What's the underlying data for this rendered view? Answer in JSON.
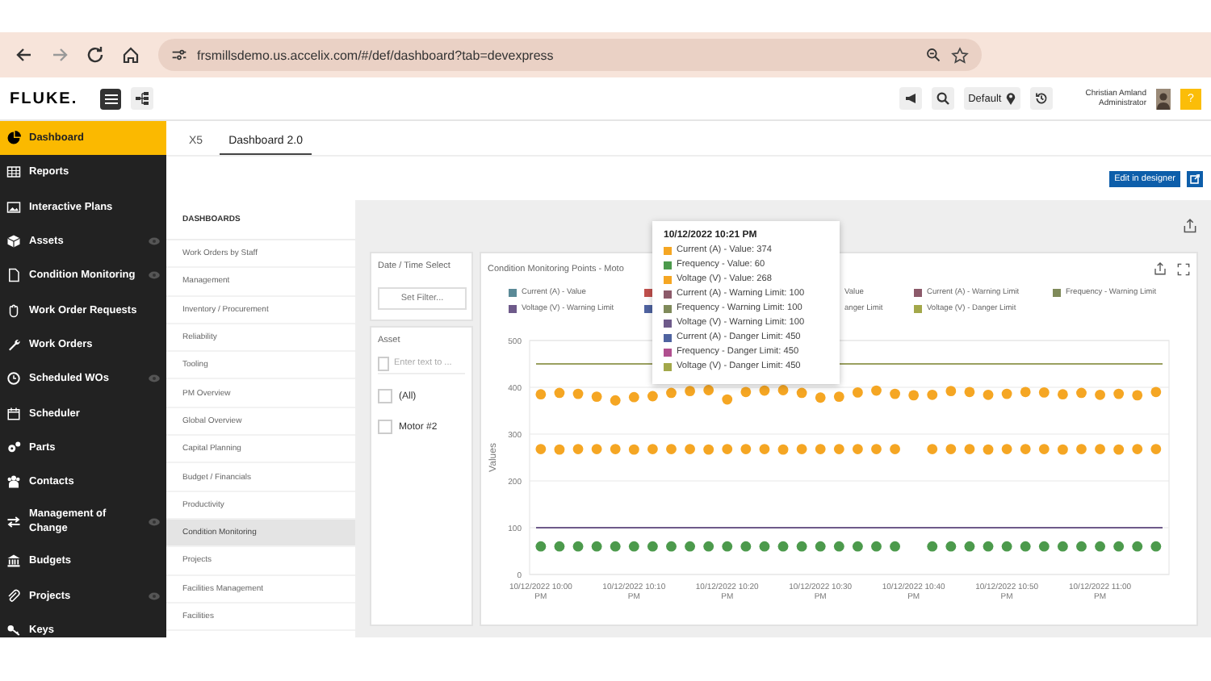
{
  "browser": {
    "url": "frsmillsdemo.us.accelix.com/#/def/dashboard?tab=devexpress"
  },
  "header": {
    "logo": "FLUKE.",
    "profile": "Default",
    "user_name": "Christian Amland",
    "user_role": "Administrator",
    "help": "?"
  },
  "sidebar": {
    "items": [
      {
        "label": "Dashboard",
        "selected": true,
        "eye": false
      },
      {
        "label": "Reports",
        "selected": false,
        "eye": false
      },
      {
        "label": "Interactive Plans",
        "selected": false,
        "eye": false
      },
      {
        "label": "Assets",
        "selected": false,
        "eye": true
      },
      {
        "label": "Condition Monitoring",
        "selected": false,
        "eye": true
      },
      {
        "label": "Work Order Requests",
        "selected": false,
        "eye": false
      },
      {
        "label": "Work Orders",
        "selected": false,
        "eye": false
      },
      {
        "label": "Scheduled WOs",
        "selected": false,
        "eye": true
      },
      {
        "label": "Scheduler",
        "selected": false,
        "eye": false
      },
      {
        "label": "Parts",
        "selected": false,
        "eye": false
      },
      {
        "label": "Contacts",
        "selected": false,
        "eye": false
      },
      {
        "label": "Management of Change",
        "selected": false,
        "eye": true
      },
      {
        "label": "Budgets",
        "selected": false,
        "eye": false
      },
      {
        "label": "Projects",
        "selected": false,
        "eye": true
      },
      {
        "label": "Keys",
        "selected": false,
        "eye": false
      }
    ]
  },
  "tabs": [
    {
      "label": "X5",
      "selected": false
    },
    {
      "label": "Dashboard 2.0",
      "selected": true
    }
  ],
  "edit_button": "Edit in designer",
  "dashboards": {
    "heading": "DASHBOARDS",
    "items": [
      {
        "label": "Work Orders by Staff",
        "selected": false
      },
      {
        "label": "Management",
        "selected": false
      },
      {
        "label": "Inventory / Procurement",
        "selected": false
      },
      {
        "label": "Reliability",
        "selected": false
      },
      {
        "label": "Tooling",
        "selected": false
      },
      {
        "label": "PM Overview",
        "selected": false
      },
      {
        "label": "Global Overview",
        "selected": false
      },
      {
        "label": "Capital Planning",
        "selected": false
      },
      {
        "label": "Budget / Financials",
        "selected": false
      },
      {
        "label": "Productivity",
        "selected": false
      },
      {
        "label": "Condition Monitoring",
        "selected": true
      },
      {
        "label": "Projects",
        "selected": false
      },
      {
        "label": "Facilities Management",
        "selected": false
      },
      {
        "label": "Facilities",
        "selected": false
      }
    ]
  },
  "date_filter": {
    "title": "Date / Time Select",
    "button": "Set Filter..."
  },
  "asset_filter": {
    "title": "Asset",
    "placeholder": "Enter text to ...",
    "select_all_checked": false,
    "options": [
      {
        "label": "(All)",
        "checked": false
      },
      {
        "label": "Motor #2",
        "checked": false
      }
    ]
  },
  "chart_panel": {
    "title": "Condition Monitoring Points - Moto",
    "legend": [
      {
        "label": "Current (A) - Value",
        "color": "#5b8a97"
      },
      {
        "color": "#c0504d"
      },
      {
        "label": "Value"
      },
      {
        "label": "Current (A) - Warning Limit",
        "color": "#8c5a6a"
      },
      {
        "label": "Frequency - Warning Limit",
        "color": "#7f8a5a"
      },
      {
        "label": "Voltage (V) - Warning Limit",
        "color": "#6e5a8a"
      },
      {
        "color": "#4f63a0"
      },
      {
        "label": "anger Limit"
      },
      {
        "label": "Voltage (V) - Danger Limit",
        "color": "#a3a84a"
      }
    ],
    "chart_data": {
      "type": "scatter",
      "ylabel": "Values",
      "ylim": [
        0,
        500
      ],
      "yticks": [
        0,
        100,
        200,
        300,
        400,
        500
      ],
      "categories": [
        "10/12/2022 10:00 PM",
        null,
        null,
        null,
        null,
        "10/12/2022 10:10 PM",
        null,
        null,
        null,
        null,
        "10/12/2022 10:20 PM",
        null,
        null,
        null,
        null,
        "10/12/2022 10:30 PM",
        null,
        null,
        null,
        null,
        "10/12/2022 10:40 PM",
        null,
        null,
        null,
        null,
        "10/12/2022 10:50 PM",
        null,
        null,
        null,
        null,
        "10/12/2022 11:00 PM",
        null,
        null,
        null
      ],
      "series": [
        {
          "color": "#f5a623",
          "values": [
            385,
            388,
            386,
            380,
            372,
            379,
            381,
            388,
            392,
            394,
            374,
            390,
            393,
            394,
            388,
            378,
            380,
            389,
            393,
            386,
            383,
            384,
            392,
            390,
            384,
            386,
            390,
            389,
            385,
            388,
            384,
            386,
            383,
            390
          ]
        },
        {
          "color": "#f5a623",
          "values": [
            268,
            267,
            268,
            268,
            268,
            267,
            268,
            268,
            268,
            267,
            268,
            268,
            268,
            267,
            268,
            268,
            268,
            268,
            268,
            268,
            null,
            268,
            268,
            268,
            267,
            268,
            268,
            268,
            267,
            268,
            268,
            267,
            268,
            268
          ]
        },
        {
          "color": "#4c9a4c",
          "values": [
            60,
            60,
            60,
            60,
            60,
            60,
            60,
            60,
            60,
            60,
            60,
            60,
            60,
            60,
            60,
            60,
            60,
            60,
            60,
            60,
            null,
            60,
            60,
            60,
            60,
            60,
            60,
            60,
            60,
            60,
            60,
            60,
            60,
            60
          ]
        }
      ],
      "grid": true,
      "ref_lines": [
        {
          "axis": "y",
          "value": 450,
          "color": "#9aa060"
        },
        {
          "axis": "y",
          "value": 100,
          "color": "#6e5a8a"
        }
      ]
    }
  },
  "tooltip": {
    "title": "10/12/2022 10:21 PM",
    "rows": [
      {
        "label": "Current (A) - Value: 374",
        "color": "#f5a623"
      },
      {
        "label": "Frequency - Value: 60",
        "color": "#4c9a4c"
      },
      {
        "label": "Voltage (V) - Value: 268",
        "color": "#f5a623"
      },
      {
        "label": "Current (A) - Warning Limit: 100",
        "color": "#8c5a6a"
      },
      {
        "label": "Frequency - Warning Limit: 100",
        "color": "#7f8a5a"
      },
      {
        "label": "Voltage (V) - Warning Limit: 100",
        "color": "#6e5a8a"
      },
      {
        "label": "Current (A) - Danger Limit: 450",
        "color": "#4f63a0"
      },
      {
        "label": "Frequency - Danger Limit: 450",
        "color": "#b04f8f"
      },
      {
        "label": "Voltage (V) - Danger Limit: 450",
        "color": "#a3a84a"
      }
    ]
  }
}
